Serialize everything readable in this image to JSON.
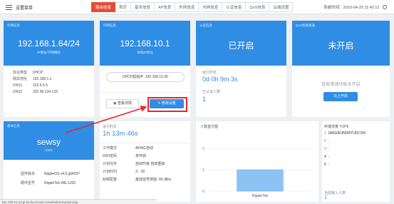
{
  "header": {
    "app_title": "设置菜单",
    "nav": [
      {
        "label": "路由信息",
        "active": true
      },
      {
        "label": "首页",
        "active": false
      },
      {
        "label": "基本信息",
        "active": false
      },
      {
        "label": "AP信息",
        "active": false
      },
      {
        "label": "外网信息",
        "active": false
      },
      {
        "label": "内网信息",
        "active": false
      },
      {
        "label": "认证信息",
        "active": false
      },
      {
        "label": "QoS信息",
        "active": false
      },
      {
        "label": "云端设置",
        "active": false
      }
    ],
    "system_time": "系统时间：2015-04-25 11:42:12"
  },
  "wan": {
    "section": "外网信息",
    "ip": "192.168.1.64/24",
    "ip_caption": "IP地址/子网掩码",
    "rows": [
      {
        "k": "协议类型",
        "v": "DHCP"
      },
      {
        "k": "网关地址",
        "v": "192.168.1.1"
      },
      {
        "k": "DNS1",
        "v": "223.5.5.5"
      },
      {
        "k": "DNS2",
        "v": "202.96.134.133"
      }
    ]
  },
  "lan": {
    "section": "内网信息",
    "ip": "192.168.10.1",
    "ip_caption": "本机IP地址",
    "dhcp_label": "DHCP起始IP",
    "dhcp_value": "192.168.10.30",
    "view_button": "查看详情",
    "modify_button": "修改设置"
  },
  "auth": {
    "section": "认证信息",
    "status": "已开启",
    "runtime_label": "运行时长",
    "runtime_value": "0d 0h 9m 3s",
    "authed_label": "已认证人数",
    "authed_value": "1"
  },
  "qos": {
    "section": "QoS智能限速",
    "status": "未开启",
    "hint": "智能限速功能未开启",
    "enable_button": "马上开启"
  },
  "basic": {
    "section": "基本信息",
    "device_name": "sewsy",
    "device_caption": "SSID",
    "rows": [
      {
        "k": "固件版本",
        "v": "RippleOS v4.5 git4537"
      },
      {
        "k": "硬件型号",
        "v": "RippleTek WE-1202"
      }
    ]
  },
  "ap": {
    "runtime_label": "运行时长",
    "runtime_value": "1h 13m 46s",
    "rows": [
      {
        "k": "工作模式",
        "v": "AP/AC自动"
      },
      {
        "k": "WiFi密码",
        "v": "未开启"
      },
      {
        "k": "计划任务",
        "v": "自动升级  自动重启"
      },
      {
        "k": "计划时间",
        "v": "3：00"
      },
      {
        "k": "射频配置",
        "v": "最佳信号增强 -90 dBm"
      }
    ]
  },
  "users_chart": {
    "title": "人数直方图",
    "ylabel_ticks": [
      "2",
      "1",
      "0"
    ],
    "bar_label": "RippleTek"
  },
  "chart_data": {
    "type": "bar",
    "title": "人数直方图",
    "categories": [
      "RippleTek"
    ],
    "values": [
      1
    ],
    "ylim": [
      0,
      2
    ]
  },
  "traffic": {
    "title": "终端流量 TOP5",
    "items": [
      {
        "rank": "1",
        "name": "UMG0E3NDRYUDCSN"
      },
      {
        "rank": "2",
        "name": "-"
      },
      {
        "rank": "3",
        "name": "-"
      },
      {
        "rank": "4",
        "name": "-"
      },
      {
        "rank": "5",
        "name": "-"
      }
    ],
    "online_label": "当前接入人数",
    "online_value": "1"
  },
  "statusbar": {
    "text": "192.168.10.1/cgi-bin/luci/;stok=b1a5/admin/system/ap"
  },
  "colors": {
    "primary": "#2f8de4",
    "active_tab": "#e64b35",
    "highlight": "#e6262b"
  }
}
